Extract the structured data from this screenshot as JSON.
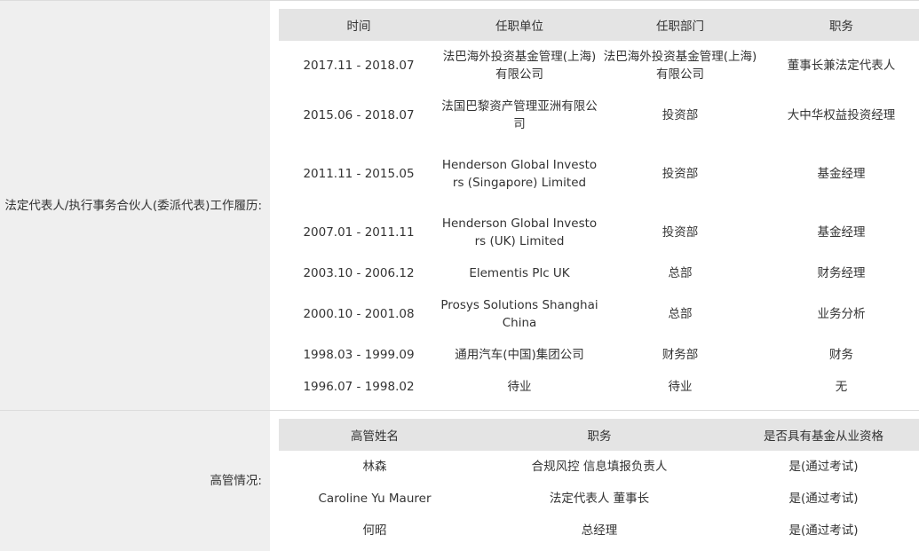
{
  "work_history": {
    "label": "法定代表人/执行事务合伙人(委派代表)工作履历:",
    "headers": [
      "时间",
      "任职单位",
      "任职部门",
      "职务"
    ],
    "rows": [
      [
        "2017.11 - 2018.07",
        "法巴海外投资基金管理(上海)有限公司",
        "法巴海外投资基金管理(上海)有限公司",
        "董事长兼法定代表人"
      ],
      [
        "2015.06 - 2018.07",
        "法国巴黎资产管理亚洲有限公司",
        "投资部",
        "大中华权益投资经理"
      ],
      [
        "2011.11 - 2015.05",
        "Henderson Global Investors (Singapore) Limited",
        "投资部",
        "基金经理"
      ],
      [
        "2007.01 - 2011.11",
        "Henderson Global Investors (UK) Limited",
        "投资部",
        "基金经理"
      ],
      [
        "2003.10 - 2006.12",
        "Elementis Plc UK",
        "总部",
        "财务经理"
      ],
      [
        "2000.10 - 2001.08",
        "Prosys Solutions Shanghai China",
        "总部",
        "业务分析"
      ],
      [
        "1998.03 - 1999.09",
        "通用汽车(中国)集团公司",
        "财务部",
        "财务"
      ],
      [
        "1996.07 - 1998.02",
        "待业",
        "待业",
        "无"
      ]
    ]
  },
  "executives": {
    "label": "高管情况:",
    "headers": [
      "高管姓名",
      "职务",
      "是否具有基金从业资格"
    ],
    "rows": [
      [
        "林森",
        "合规风控 信息填报负责人",
        "是(通过考试)"
      ],
      [
        "Caroline Yu Maurer",
        "法定代表人 董事长",
        "是(通过考试)"
      ],
      [
        "何昭",
        "总经理",
        "是(通过考试)"
      ]
    ]
  }
}
